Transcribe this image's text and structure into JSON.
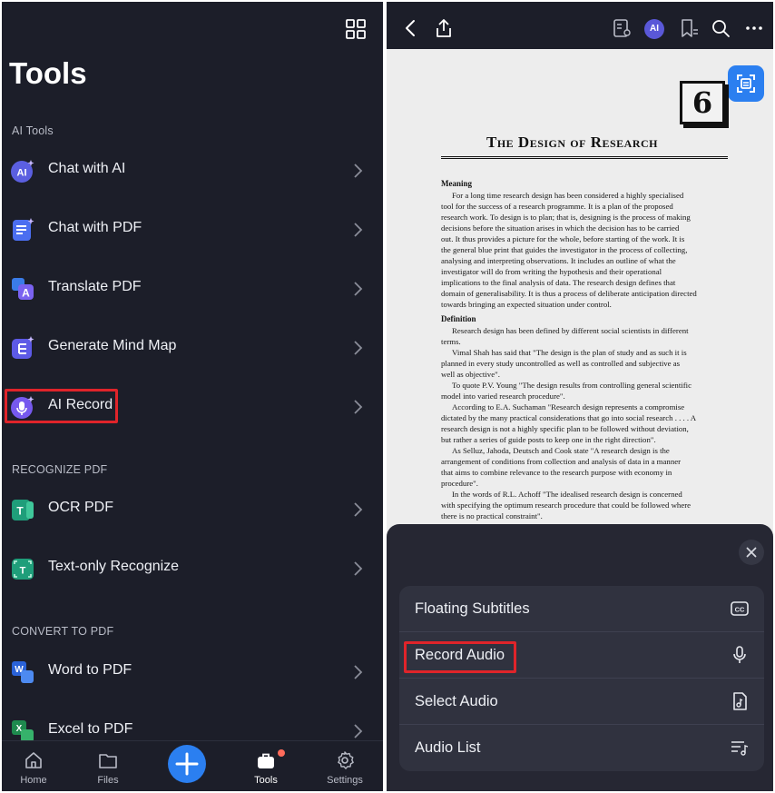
{
  "left": {
    "title": "Tools",
    "sections": {
      "ai_tools": "AI Tools",
      "recognize_pdf": "RECOGNIZE PDF",
      "convert_to_pdf": "CONVERT TO PDF"
    },
    "items": [
      {
        "label": "Chat with AI",
        "icon": "ai-chat-icon"
      },
      {
        "label": "Chat with PDF",
        "icon": "pdf-chat-icon"
      },
      {
        "label": "Translate PDF",
        "icon": "translate-icon"
      },
      {
        "label": "Generate Mind Map",
        "icon": "mind-map-icon"
      },
      {
        "label": "AI Record",
        "icon": "microphone-icon"
      },
      {
        "label": "OCR PDF",
        "icon": "ocr-icon"
      },
      {
        "label": "Text-only Recognize",
        "icon": "text-recognize-icon"
      },
      {
        "label": "Word to PDF",
        "icon": "word-icon"
      },
      {
        "label": "Excel to PDF",
        "icon": "excel-icon"
      }
    ],
    "tabbar": {
      "home": "Home",
      "files": "Files",
      "tools": "Tools",
      "settings": "Settings"
    }
  },
  "right": {
    "ai_badge": "AI",
    "document": {
      "chapter_number": "6",
      "title": "The Design of Research",
      "heading_meaning": "Meaning",
      "meaning_lines": [
        "For a long time research design has been considered a highly specialised",
        "tool for the success of a research programme. It is a plan of the proposed",
        "research work. To design is to plan; that is, designing is the process of making",
        "decisions before the situation arises in which the decision has to be carried",
        "out. It thus provides a picture for the whole, before starting of the work. It is",
        "the general blue print that guides the investigator in the process of collecting,",
        "analysing and interpreting observations. It includes an outline of what the",
        "investigator will do from writing the hypothesis and their operational",
        "implications to the final analysis of data. The research design defines that",
        "domain of generalisability. It is thus a process of deliberate anticipation directed",
        "towards bringing an expected situation under control."
      ],
      "heading_definition": "Definition",
      "definition_lines": [
        "Research design has been defined by different social scientists in different",
        "terms.",
        "Vimal Shah has said that \"The design is the plan of study and as such it is",
        "planned in every study uncontrolled as well as controlled and subjective as",
        "well as objective\".",
        "To quote P.V. Young \"The design results from controlling general scientific",
        "model into varied research procedure\".",
        "According to E.A. Suchaman \"Research design represents a compromise",
        "dictated by the many practical considerations that go into social research . . . . A",
        "research design is not a highly specific plan to be followed without deviation,",
        "but rather a series of guide posts to keep one in the right direction\".",
        "As Selluz, Jahoda, Deutsch and Cook state \"A research design is the",
        "arrangement of conditions from collection and analysis of data in a manner",
        "that aims to combine relevance to the research purpose with economy in",
        "procedure\".",
        "In the words of R.L. Achoff \"The idealised research design is concerned",
        "with specifying the optimum research procedure that could be followed where",
        "there is no practical constraint\"."
      ]
    },
    "sheet": {
      "items": [
        {
          "label": "Floating Subtitles",
          "icon": "cc-icon"
        },
        {
          "label": "Record Audio",
          "icon": "microphone-icon"
        },
        {
          "label": "Select Audio",
          "icon": "audio-file-icon"
        },
        {
          "label": "Audio List",
          "icon": "playlist-icon"
        }
      ]
    }
  }
}
